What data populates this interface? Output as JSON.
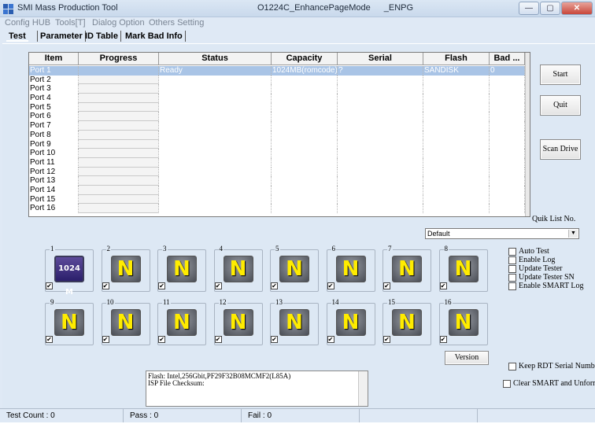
{
  "titlebar": {
    "app_title": "SMI Mass Production Tool",
    "center_title": "O1224C_EnhancePageMode _ENPG",
    "minimize": "—",
    "maximize": "▢",
    "close": "✕"
  },
  "menu": [
    "Config HUB",
    "Tools[T]",
    "Dialog Option",
    "Others Setting"
  ],
  "tabs": [
    "Test",
    "Parameter",
    "ID Table",
    "Mark Bad Info"
  ],
  "table": {
    "columns": [
      "Item",
      "Progress",
      "Status",
      "Capacity",
      "Serial",
      "Flash",
      "Bad ..."
    ],
    "rows": [
      {
        "item": "Port 1",
        "progress": "",
        "status": "Ready",
        "capacity": "1024MB(romcode)",
        "serial": "?",
        "flash": "SANDISK",
        "bad": "0"
      },
      {
        "item": "Port 2",
        "progress": "",
        "status": "",
        "capacity": "",
        "serial": "",
        "flash": "",
        "bad": ""
      },
      {
        "item": "Port 3",
        "progress": "",
        "status": "",
        "capacity": "",
        "serial": "",
        "flash": "",
        "bad": ""
      },
      {
        "item": "Port 4",
        "progress": "",
        "status": "",
        "capacity": "",
        "serial": "",
        "flash": "",
        "bad": ""
      },
      {
        "item": "Port 5",
        "progress": "",
        "status": "",
        "capacity": "",
        "serial": "",
        "flash": "",
        "bad": ""
      },
      {
        "item": "Port 6",
        "progress": "",
        "status": "",
        "capacity": "",
        "serial": "",
        "flash": "",
        "bad": ""
      },
      {
        "item": "Port 7",
        "progress": "",
        "status": "",
        "capacity": "",
        "serial": "",
        "flash": "",
        "bad": ""
      },
      {
        "item": "Port 8",
        "progress": "",
        "status": "",
        "capacity": "",
        "serial": "",
        "flash": "",
        "bad": ""
      },
      {
        "item": "Port 9",
        "progress": "",
        "status": "",
        "capacity": "",
        "serial": "",
        "flash": "",
        "bad": ""
      },
      {
        "item": "Port 10",
        "progress": "",
        "status": "",
        "capacity": "",
        "serial": "",
        "flash": "",
        "bad": ""
      },
      {
        "item": "Port 11",
        "progress": "",
        "status": "",
        "capacity": "",
        "serial": "",
        "flash": "",
        "bad": ""
      },
      {
        "item": "Port 12",
        "progress": "",
        "status": "",
        "capacity": "",
        "serial": "",
        "flash": "",
        "bad": ""
      },
      {
        "item": "Port 13",
        "progress": "",
        "status": "",
        "capacity": "",
        "serial": "",
        "flash": "",
        "bad": ""
      },
      {
        "item": "Port 14",
        "progress": "",
        "status": "",
        "capacity": "",
        "serial": "",
        "flash": "",
        "bad": ""
      },
      {
        "item": "Port 15",
        "progress": "",
        "status": "",
        "capacity": "",
        "serial": "",
        "flash": "",
        "bad": ""
      },
      {
        "item": "Port 16",
        "progress": "",
        "status": "",
        "capacity": "",
        "serial": "",
        "flash": "",
        "bad": ""
      }
    ]
  },
  "buttons": {
    "start": "Start",
    "quit": "Quit",
    "scan_drive": "Scan Drive",
    "version": "Version"
  },
  "quick_list": {
    "label": "Quik List No.",
    "selected": "Default",
    "arrow": "▼"
  },
  "slots": [
    {
      "num": "1",
      "glyph": "1024 M",
      "active": true,
      "checked": true
    },
    {
      "num": "2",
      "glyph": "N",
      "active": false,
      "checked": true
    },
    {
      "num": "3",
      "glyph": "N",
      "active": false,
      "checked": true
    },
    {
      "num": "4",
      "glyph": "N",
      "active": false,
      "checked": true
    },
    {
      "num": "5",
      "glyph": "N",
      "active": false,
      "checked": true
    },
    {
      "num": "6",
      "glyph": "N",
      "active": false,
      "checked": true
    },
    {
      "num": "7",
      "glyph": "N",
      "active": false,
      "checked": true
    },
    {
      "num": "8",
      "glyph": "N",
      "active": false,
      "checked": true
    },
    {
      "num": "9",
      "glyph": "N",
      "active": false,
      "checked": true
    },
    {
      "num": "10",
      "glyph": "N",
      "active": false,
      "checked": true
    },
    {
      "num": "11",
      "glyph": "N",
      "active": false,
      "checked": true
    },
    {
      "num": "12",
      "glyph": "N",
      "active": false,
      "checked": true
    },
    {
      "num": "13",
      "glyph": "N",
      "active": false,
      "checked": true
    },
    {
      "num": "14",
      "glyph": "N",
      "active": false,
      "checked": true
    },
    {
      "num": "15",
      "glyph": "N",
      "active": false,
      "checked": true
    },
    {
      "num": "16",
      "glyph": "N",
      "active": false,
      "checked": true
    }
  ],
  "check_mark": "✔",
  "options": [
    "Auto Test",
    "Enable Log",
    "Update Tester",
    "Update Tester SN",
    "Enable SMART Log"
  ],
  "keep_rdt": "Keep RDT Serial Number",
  "clear_smart": "Clear SMART and Unformat",
  "log": {
    "line1": "Flash: Intel,256Gbit,PF29F32B08MCMF2(L85A)",
    "line2": "ISP File Checksum:"
  },
  "status": {
    "test_count": "Test Count : 0",
    "pass": "Pass : 0",
    "fail": "Fail : 0"
  },
  "colors": {
    "selection": "#a9c4e6",
    "n_glyph": "#ffec00"
  }
}
